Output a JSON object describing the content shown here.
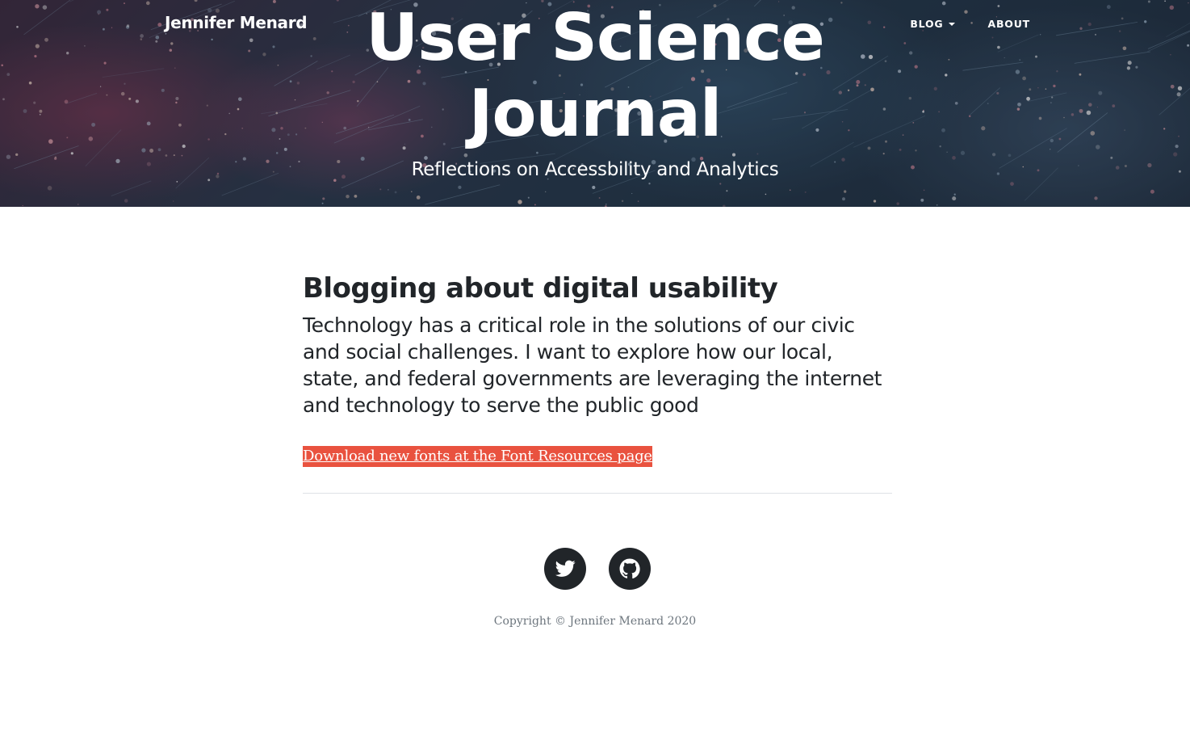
{
  "header": {
    "brand": "Jennifer Menard",
    "nav": {
      "blog_label": "BLOG",
      "about_label": "ABOUT"
    },
    "title_line1": "User Science",
    "title_line2": "Journal",
    "subtitle": "Reflections on Accessbility and Analytics"
  },
  "main": {
    "heading": "Blogging about digital usability",
    "intro": "Technology has a critical role in the solutions of our civic and social challenges. I want to explore how our local, state, and federal governments are leveraging the internet and technology to serve the public good",
    "font_link": "Download new fonts at the Font Resources page"
  },
  "footer": {
    "social": [
      {
        "name": "twitter",
        "icon": "twitter-icon"
      },
      {
        "name": "github",
        "icon": "github-icon"
      }
    ],
    "copyright": "Copyright © Jennifer Menard 2020"
  },
  "colors": {
    "link_highlight": "#e9523f",
    "text_dark": "#212529",
    "text_muted": "#6c757d",
    "divider": "#dee2e6"
  }
}
